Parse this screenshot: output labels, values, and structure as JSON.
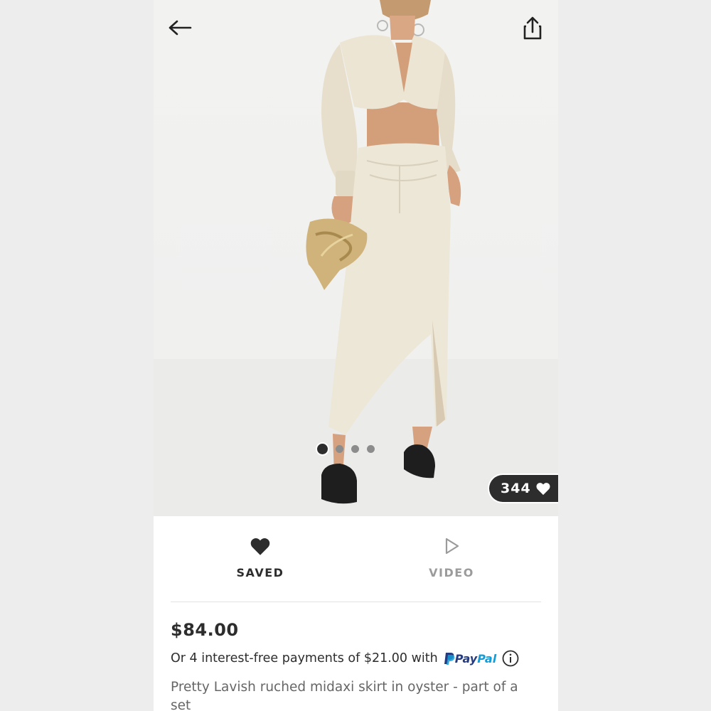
{
  "product": {
    "likes_count": "344",
    "image_count": 4,
    "active_image": 1
  },
  "actions": {
    "saved_label": "SAVED",
    "video_label": "VIDEO"
  },
  "pricing": {
    "price": "$84.00",
    "installment_text": "Or 4 interest-free payments of $21.00 with",
    "paypal_brand": {
      "p1": "Pay",
      "p2": "Pal"
    }
  },
  "description": {
    "title": "Pretty Lavish ruched midaxi skirt in oyster - part of a set"
  },
  "icons": {
    "back": "arrow-left-icon",
    "share": "share-icon",
    "heart": "heart-icon",
    "play": "play-icon",
    "info": "info-icon"
  },
  "colors": {
    "text_primary": "#2d2d2d",
    "text_muted": "#9b9b9b",
    "badge_bg": "#2d2d2d",
    "paypal_dark": "#253b80",
    "paypal_light": "#179bd7"
  }
}
